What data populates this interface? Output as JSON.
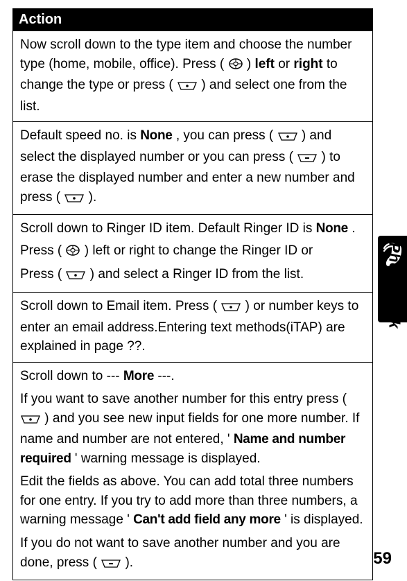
{
  "table": {
    "header": "Action",
    "rows": [
      {
        "p1a": "Now scroll down to the type item and choose the number type (home, mobile, office). Press (",
        "p1b": ") ",
        "p1bold1": "left",
        "p1c": " or ",
        "p1bold2": "right",
        "p1d": " to change the type or press (",
        "p1e": ") and select one from the list."
      },
      {
        "p1a": "Default speed no. is ",
        "p1ui1": "None",
        "p1b": ", you can press (",
        "p1c": ") and select the displayed number or you can press (",
        "p1d": ") to erase the displayed number and enter a new number and press (",
        "p1e": ")."
      },
      {
        "p1a": "Scroll down to Ringer ID item. Default Ringer ID is ",
        "p1ui1": "None",
        "p1b": ".",
        "p2a": "Press (",
        "p2b": ") left or right to change the Ringer ID or",
        "p3a": "Press (",
        "p3b": ") and select a Ringer ID from the list."
      },
      {
        "p1a": "Scroll down to Email item. Press (",
        "p1b": ") or number keys to enter an email address.Entering text methods(iTAP) are explained in page ??."
      },
      {
        "p1a": "Scroll down to ---",
        "p1ui1": "More",
        "p1b": "---.",
        "p2a": "If you want to save another number for this entry press (",
        "p2b": ") and you see new input fields for one more number. If name and number are not entered, '",
        "p2ui1": "Name and number required",
        "p2c": "' warning message is displayed.",
        "p3a": "Edit the fields as above. You can add total three numbers for one entry. If you try to add more than three numbers, a warning message '",
        "p3ui1": "Can't add field any more",
        "p3b": "' is displayed.",
        "p4a": "If you do not want to save another number and you are done, press (",
        "p4b": ")."
      }
    ]
  },
  "side": {
    "label": "Phonebook"
  },
  "page_number": "59",
  "icons": {
    "nav_circle": "nav-circle-icon",
    "soft_key_dot": "softkey-dot-icon",
    "soft_key_bar": "softkey-bar-icon"
  }
}
